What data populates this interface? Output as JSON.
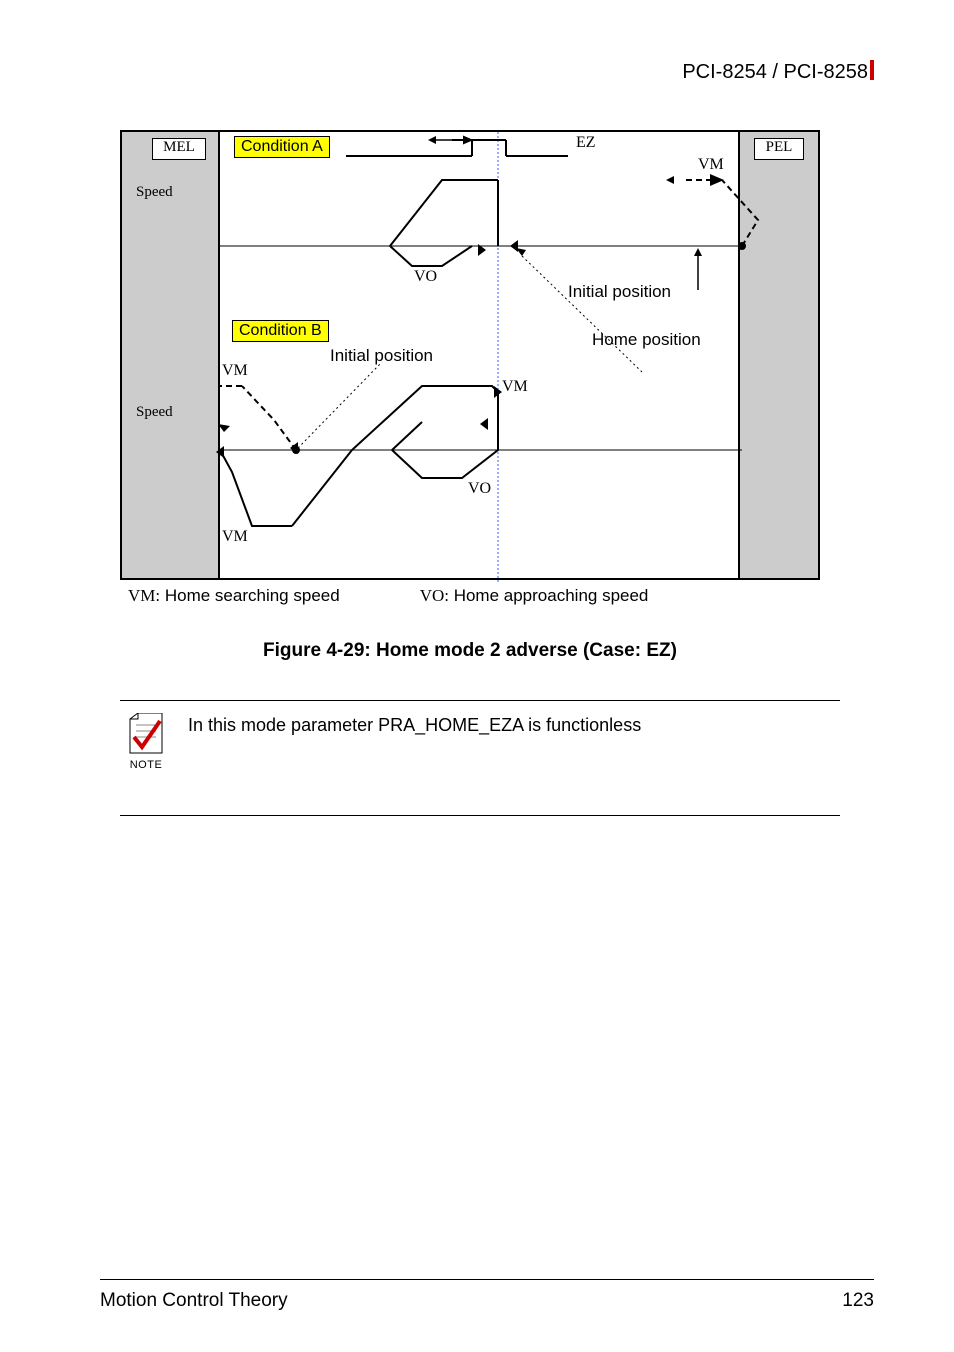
{
  "header": {
    "title": "PCI-8254 / PCI-8258"
  },
  "diagram": {
    "mel": "MEL",
    "pel": "PEL",
    "conditionA": "Condition A",
    "conditionB": "Condition B",
    "speed": "Speed",
    "ez": "EZ",
    "vm": "VM",
    "vo": "VO",
    "initialPosition": "Initial position",
    "homePosition": "Home position",
    "vmLabel": "VM:",
    "vmDesc": "Home searching speed",
    "voLabel": "VO:",
    "voDesc": "Home approaching speed"
  },
  "caption": "Figure 4-29: Home mode 2 adverse (Case:  EZ)",
  "note": {
    "label": "NOTE",
    "text": "In this mode parameter PRA_HOME_EZA is functionless"
  },
  "footer": {
    "section": "Motion Control Theory",
    "page": "123"
  }
}
